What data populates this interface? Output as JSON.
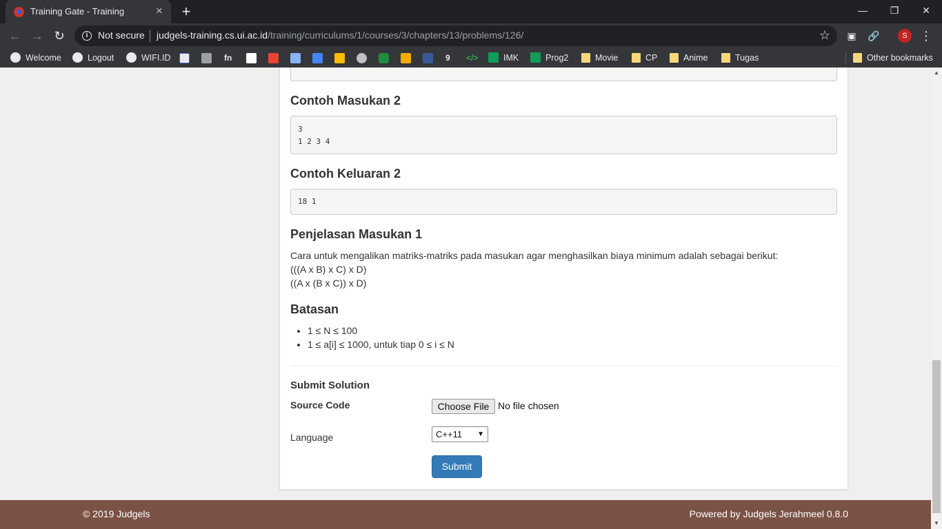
{
  "browser": {
    "tab_title": "Training Gate - Training",
    "tab_close": "×",
    "new_tab": "+",
    "security_label": "Not secure",
    "url_host": "judgels-training.cs.ui.ac.id",
    "url_path": "/training/curriculums/1/courses/3/chapters/13/problems/126/",
    "profile_initial": "S",
    "window_controls": {
      "minimize": "—",
      "restore": "❐",
      "close": "✕"
    }
  },
  "bookmarks": {
    "items": [
      {
        "label": "Welcome",
        "icon": "globe-icon"
      },
      {
        "label": "Logout",
        "icon": "globe-icon"
      },
      {
        "label": "WIFI.ID",
        "icon": "globe-icon"
      },
      {
        "label": "IMK",
        "icon": "sheets-icon"
      },
      {
        "label": "Prog2",
        "icon": "sheets-icon"
      },
      {
        "label": "Movie",
        "icon": "folder-icon"
      },
      {
        "label": "CP",
        "icon": "folder-icon"
      },
      {
        "label": "Anime",
        "icon": "folder-icon"
      },
      {
        "label": "Tugas",
        "icon": "folder-icon"
      }
    ],
    "other": "Other bookmarks"
  },
  "problem": {
    "sample_input_2_heading": "Contoh Masukan 2",
    "sample_input_2": "3\n1 2 3 4",
    "sample_output_2_heading": "Contoh Keluaran 2",
    "sample_output_2": "18 1",
    "explanation_heading": "Penjelasan Masukan 1",
    "explanation_lines": [
      "Cara untuk mengalikan matriks-matriks pada masukan agar menghasilkan biaya minimum adalah sebagai berikut:",
      "(((A x B) x C) x D)",
      "((A x (B x C)) x D)"
    ],
    "constraints_heading": "Batasan",
    "constraints": [
      "1 ≤ N ≤ 100",
      "1 ≤ a[i] ≤ 1000, untuk tiap 0 ≤ i ≤ N"
    ]
  },
  "submission": {
    "title": "Submit Solution",
    "source_label": "Source Code",
    "file_button": "Choose File",
    "file_status": "No file chosen",
    "language_label": "Language",
    "language_value": "C++11",
    "submit_label": "Submit"
  },
  "footer": {
    "left": "© 2019 Judgels",
    "right": "Powered by Judgels Jerahmeel 0.8.0"
  },
  "colors": {
    "footer_bg": "#7b5246",
    "submit_button": "#337ab7",
    "chrome_dark": "#35363a"
  }
}
